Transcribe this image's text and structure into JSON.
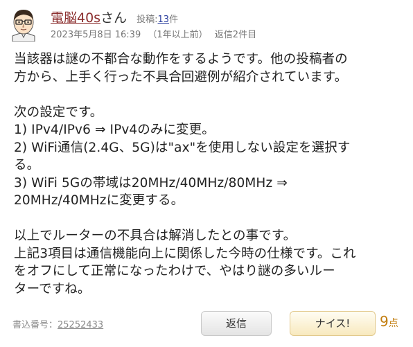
{
  "user": {
    "name": "電脳40s",
    "honorific": "さん",
    "post_count_label": "投稿:",
    "post_count": "13",
    "post_count_suffix": "件"
  },
  "meta": {
    "datetime": "2023年5月8日 16:39",
    "relative_time": "（1年以上前）",
    "replies": "返信2件目"
  },
  "body": {
    "lines": [
      "当該器は謎の不都合な動作をするようです。他の投稿者の",
      "方から、上手く行った不具合回避例が紹介されています。",
      "",
      "次の設定です。",
      "1) IPv4/IPv6 ⇒ IPv4のみに変更。",
      "2) WiFi通信(2.4G、5G)は\"ax\"を使用しない設定を選択す",
      "る。",
      "3) WiFi 5Gの帯域は20MHz/40MHz/80MHz ⇒",
      "20MHz/40MHzに変更する。",
      "",
      "以上でルーターの不具合は解消したとの事です。",
      "上記3項目は通信機能向上に関係した今時の仕様です。これ",
      "をオフにして正常になったわけで、やはり謎の多いルー",
      "ターですね。"
    ]
  },
  "footer": {
    "post_number_label": "書込番号：",
    "post_number": "25252433",
    "reply_label": "返信",
    "nice_label": "ナイス!",
    "points": "9",
    "points_unit": "点"
  },
  "colors": {
    "username": "#8c2f2f",
    "link": "#2b3f9e",
    "points": "#c27d0e"
  },
  "icons": {
    "avatar": "man-with-glasses-avatar"
  }
}
